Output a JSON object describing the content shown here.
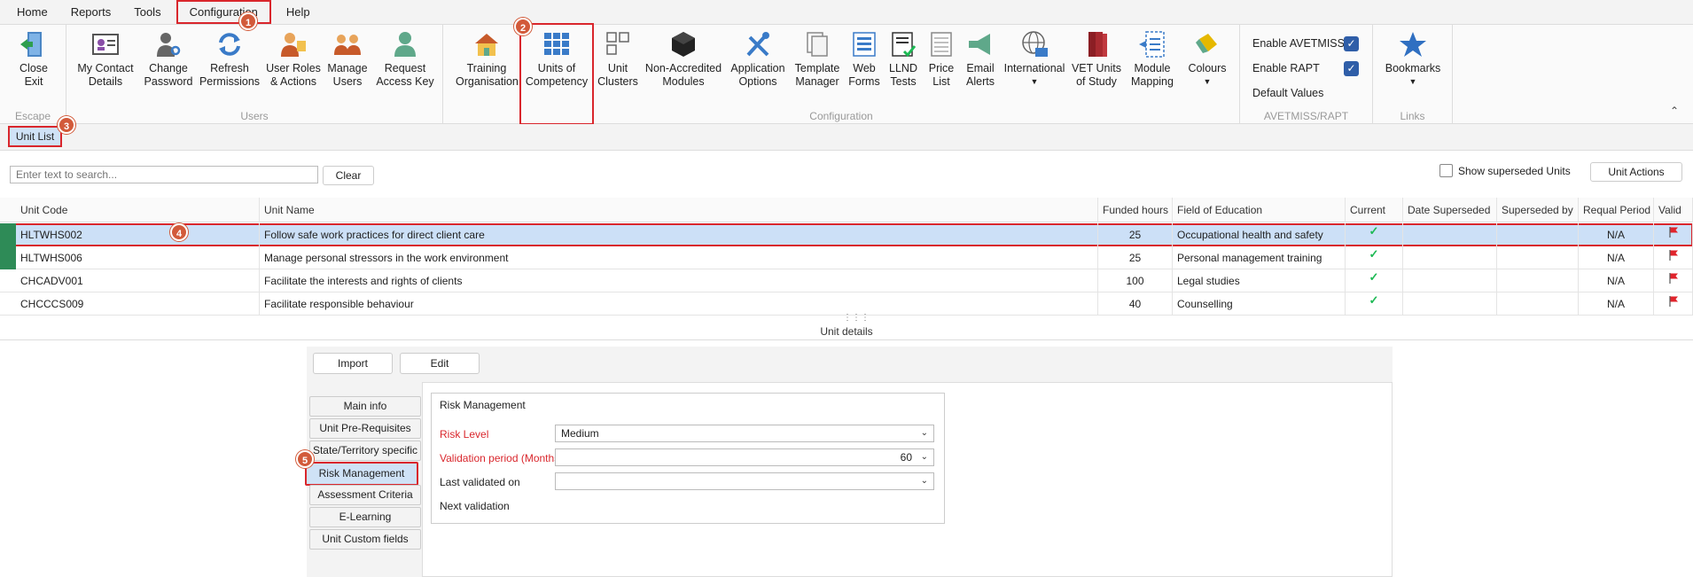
{
  "menu": {
    "items": [
      "Home",
      "Reports",
      "Tools",
      "Configuration",
      "Help"
    ]
  },
  "ribbon": {
    "escape": {
      "label": "Escape",
      "close_exit": "Close\nExit"
    },
    "users": {
      "label": "Users",
      "my_contact": "My Contact\nDetails",
      "change_password": "Change\nPassword",
      "refresh_permissions": "Refresh\nPermissions",
      "user_roles": "User Roles\n& Actions",
      "manage_users": "Manage\nUsers",
      "request_access": "Request\nAccess Key"
    },
    "configuration": {
      "label": "Configuration",
      "training_org": "Training\nOrganisation",
      "units_of_competency": "Units of\nCompetency",
      "unit_clusters": "Unit\nClusters",
      "non_accredited": "Non-Accredited\nModules",
      "application_options": "Application\nOptions",
      "template_manager": "Template\nManager",
      "web_forms": "Web\nForms",
      "llnd_tests": "LLND\nTests",
      "price_list": "Price\nList",
      "email_alerts": "Email\nAlerts",
      "international": "International",
      "vet_units": "VET Units\nof Study",
      "module_mapping": "Module\nMapping",
      "colours": "Colours"
    },
    "avetmiss": {
      "label": "AVETMISS/RAPT",
      "enable_avetmiss": "Enable AVETMISS",
      "enable_rapt": "Enable RAPT",
      "default_values": "Default Values"
    },
    "links": {
      "label": "Links",
      "bookmarks": "Bookmarks"
    }
  },
  "tabbar": {
    "unit_list": "Unit List"
  },
  "toolbar": {
    "search_placeholder": "Enter text to search...",
    "clear": "Clear",
    "show_superseded": "Show superseded Units",
    "unit_actions": "Unit Actions"
  },
  "grid": {
    "columns": [
      "Unit Code",
      "Unit Name",
      "Funded hours",
      "Field of Education",
      "Current",
      "Date Superseded",
      "Superseded by",
      "Requal Period",
      "Valid"
    ],
    "rows": [
      {
        "code": "HLTWHS002",
        "name": "Follow safe work practices for direct client care",
        "hours": "25",
        "field": "Occupational health and safety",
        "requal": "N/A"
      },
      {
        "code": "HLTWHS006",
        "name": "Manage personal stressors in the work environment",
        "hours": "25",
        "field": "Personal management training",
        "requal": "N/A"
      },
      {
        "code": "CHCADV001",
        "name": "Facilitate the interests and rights of clients",
        "hours": "100",
        "field": "Legal studies",
        "requal": "N/A"
      },
      {
        "code": "CHCCCS009",
        "name": "Facilitate responsible behaviour",
        "hours": "40",
        "field": "Counselling",
        "requal": "N/A"
      }
    ]
  },
  "details": {
    "title": "Unit details",
    "import": "Import",
    "edit": "Edit",
    "tabs": [
      "Main info",
      "Unit Pre-Requisites",
      "State/Territory specific",
      "Risk Management",
      "Assessment Criteria",
      "E-Learning",
      "Unit Custom fields"
    ],
    "risk": {
      "title": "Risk Management",
      "risk_level_label": "Risk Level",
      "risk_level_value": "Medium",
      "validation_label": "Validation period (Months)",
      "validation_value": "60",
      "last_validated_label": "Last validated on",
      "next_validation_label": "Next validation"
    }
  },
  "badges": [
    "1",
    "2",
    "3",
    "4",
    "5"
  ],
  "colors": {
    "accent": "#2f5ea8",
    "highlight": "#d9262c",
    "selected_row": "#cce0f7",
    "required_label": "#d9262c"
  }
}
